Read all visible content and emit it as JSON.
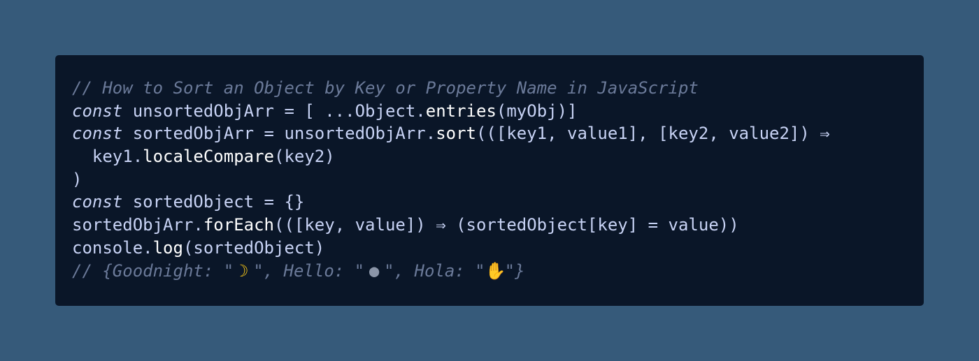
{
  "lines": {
    "l1_comment": "// How to Sort an Object by Key or Property Name in JavaScript",
    "l2_kw": "const",
    "l2_rest_a": " unsortedObjArr = [ ...",
    "l2_obj": "Object.",
    "l2_fn": "entries",
    "l2_rest_b": "(myObj)]",
    "l3_kw": "const",
    "l3_rest_a": " sortedObjArr = unsortedObjArr.",
    "l3_fn": "sort",
    "l3_rest_b": "(([key1, value1], [key2, value2]) ⇒",
    "l4_indent": "  key1.",
    "l4_fn": "localeCompare",
    "l4_rest": "(key2)",
    "l5": ")",
    "l6_kw": "const",
    "l6_rest": " sortedObject = {}",
    "l7_a": "sortedObjArr.",
    "l7_fn": "forEach",
    "l7_rest": "(([key, value]) ⇒ (sortedObject[key] = value))",
    "l8_a": "console.",
    "l8_fn": "log",
    "l8_rest": "(sortedObject)",
    "l9_a": "// {Goodnight: \"",
    "l9_b": "\", Hello: \"",
    "l9_c": "\", Hola: \"",
    "l9_d": "\"}"
  },
  "emoji": {
    "moon": "☽",
    "globe": "●",
    "hand": "✋"
  },
  "colors": {
    "background": "#365a7a",
    "card": "#0a1628",
    "comment": "#6b7a99",
    "text": "#c8d3f5"
  }
}
